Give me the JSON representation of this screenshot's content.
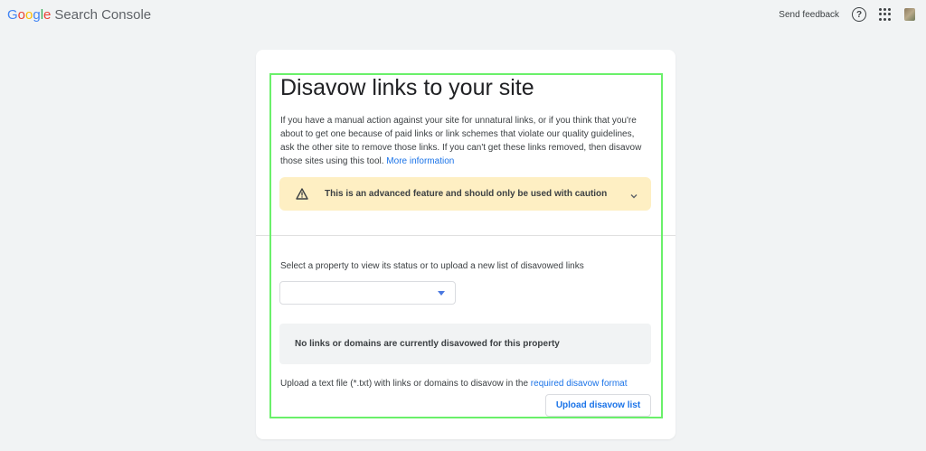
{
  "header": {
    "logo_google": "Google",
    "logo_product": "Search Console",
    "send_feedback": "Send feedback",
    "help_icon": "help-circle-icon",
    "apps_icon": "apps-grid-icon"
  },
  "main": {
    "title": "Disavow links to your site",
    "intro": "If you have a manual action against your site for unnatural links, or if you think that you're about to get one because of paid links or link schemes that violate our quality guidelines, ask the other site to remove those links. If you can't get these links removed, then disavow those sites using this tool.",
    "more_info_link": "More information",
    "warning": {
      "text": "This is an advanced feature and should only be used with caution",
      "icon": "warning-triangle-icon",
      "expand_icon": "chevron-down-icon"
    },
    "select_label": "Select a property to view its status or to upload a new list of disavowed links",
    "property_select_value": "",
    "status_message": "No links or domains are currently disavowed for this property",
    "upload_text": "Upload a text file (*.txt) with links or domains to disavow in the",
    "format_link": "required disavow format",
    "upload_button": "Upload disavow list"
  },
  "colors": {
    "accent": "#1a73e8",
    "warning_bg": "#feefc3",
    "highlight": "#6af06a",
    "background": "#f1f3f4"
  }
}
